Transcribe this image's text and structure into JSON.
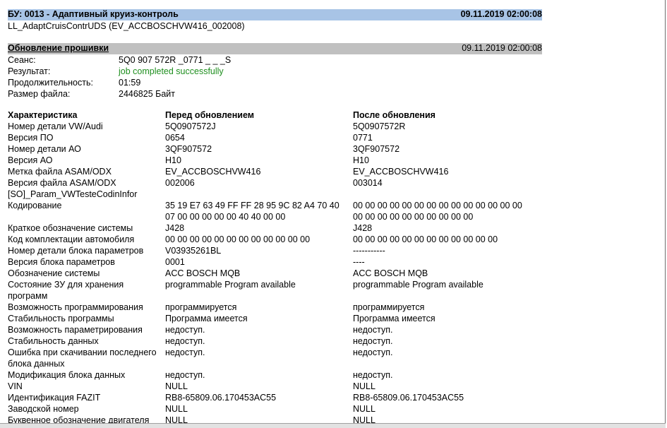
{
  "header": {
    "title": "БУ: 0013 - Адаптивный круиз-контроль",
    "datetime": "09.11.2019 02:00:08",
    "subtitle": "LL_AdaptCruisContrUDS (EV_ACCBOSCHVW416_002008)"
  },
  "section": {
    "title": "Обновление прошивки",
    "datetime": "09.11.2019 02:00:08"
  },
  "info": {
    "session_label": "Сеанс:",
    "session_value": "5Q0 907 572R _0771 _ _ _S",
    "result_label": "Результат:",
    "result_value": "job completed successfully",
    "duration_label": "Продолжительность:",
    "duration_value": "01:59",
    "filesize_label": "Размер файла:",
    "filesize_value": "2446825 Байт"
  },
  "table": {
    "headers": [
      "Характеристика",
      "Перед обновлением",
      "После обновления"
    ],
    "rows": [
      [
        "Номер детали VW/Audi",
        "5Q0907572J",
        "5Q0907572R"
      ],
      [
        "Версия ПО",
        "0654",
        "0771"
      ],
      [
        "Номер детали АО",
        "3QF907572",
        "3QF907572"
      ],
      [
        "Версия АО",
        "H10",
        "H10"
      ],
      [
        "Метка файла ASAM/ODX",
        "EV_ACCBOSCHVW416",
        "EV_ACCBOSCHVW416"
      ],
      [
        "Версия файла ASAM/ODX",
        "002006",
        "003014"
      ],
      [
        "[SO]_Param_VWTesteCodinInfor",
        "",
        ""
      ],
      [
        "Кодирование",
        "35 19 E7 63 49 FF FF 28 95 9C 82 A4 70 40",
        "00 00 00 00 00 00 00 00 00 00 00 00 00 00"
      ],
      [
        "",
        "07 00 00 00 00 00 40 40 00 00",
        "00 00 00 00 00 00 00 00 00 00"
      ],
      [
        "Краткое обозначение системы",
        "J428",
        "J428"
      ],
      [
        "Код комплектации автомобиля",
        "00 00 00 00 00 00 00 00 00 00 00 00",
        "00 00 00 00 00 00 00 00 00 00 00 00"
      ],
      [
        "Номер детали блока параметров",
        "V03935261BL",
        "-----------"
      ],
      [
        "Версия блока параметров",
        "0001",
        "----"
      ],
      [
        "Обозначение системы",
        "ACC BOSCH MQB",
        "ACC BOSCH MQB"
      ],
      [
        "Состояние ЗУ для хранения",
        "programmable Program available",
        "programmable Program available"
      ],
      [
        "программ",
        "",
        ""
      ],
      [
        "Возможность программирования",
        "программируется",
        "программируется"
      ],
      [
        "Стабильность программы",
        "Программа имеется",
        "Программа имеется"
      ],
      [
        "Возможность параметрирования",
        "недоступ.",
        "недоступ."
      ],
      [
        "Стабильность данных",
        "недоступ.",
        "недоступ."
      ],
      [
        "Ошибка при скачивании последнего",
        "недоступ.",
        "недоступ."
      ],
      [
        "блока данных",
        "",
        ""
      ],
      [
        "Модификация блока данных",
        "недоступ.",
        "недоступ."
      ],
      [
        "VIN",
        "NULL",
        "NULL"
      ],
      [
        "Идентификация FAZIT",
        "RB8-65809.06.170453AC55",
        "RB8-65809.06.170453AC55"
      ],
      [
        "Заводской номер",
        "NULL",
        "NULL"
      ],
      [
        "Буквенное обозначение двигателя",
        "NULL",
        "NULL"
      ]
    ]
  }
}
